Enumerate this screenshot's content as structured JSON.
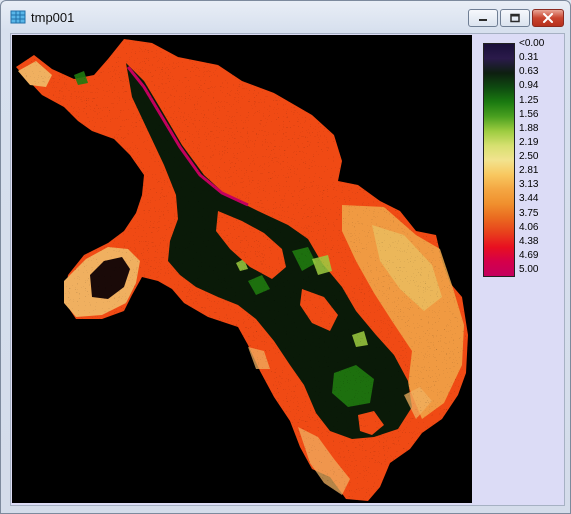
{
  "window": {
    "title": "tmp001",
    "icon": "raster-grid-icon"
  },
  "controls": {
    "minimize": "minimize-icon",
    "maximize": "maximize-icon",
    "close": "close-icon"
  },
  "legend": {
    "labels": [
      "<0.00",
      "0.31",
      "0.63",
      "0.94",
      "1.25",
      "1.56",
      "1.88",
      "2.19",
      "2.50",
      "2.81",
      "3.13",
      "3.44",
      "3.75",
      "4.06",
      "4.38",
      "4.69",
      "5.00"
    ],
    "colors": [
      "#1a0f3a",
      "#2a1a4a",
      "#0d1f10",
      "#0e4a10",
      "#1a7a10",
      "#4aa020",
      "#9ccc40",
      "#d6e070",
      "#f2e38e",
      "#f8c860",
      "#f4a743",
      "#f0902e",
      "#ea6a20",
      "#e8401c",
      "#e81020",
      "#d5004a",
      "#c4005e"
    ]
  },
  "colors": {
    "map_background": "#000000",
    "terrain_main": "#f04a14",
    "terrain_tan": "#f0b060",
    "terrain_yellow": "#e8d070",
    "vegetation_dark": "#0a1a08",
    "vegetation_green": "#1f7a10",
    "accent_magenta": "#c4005e"
  }
}
